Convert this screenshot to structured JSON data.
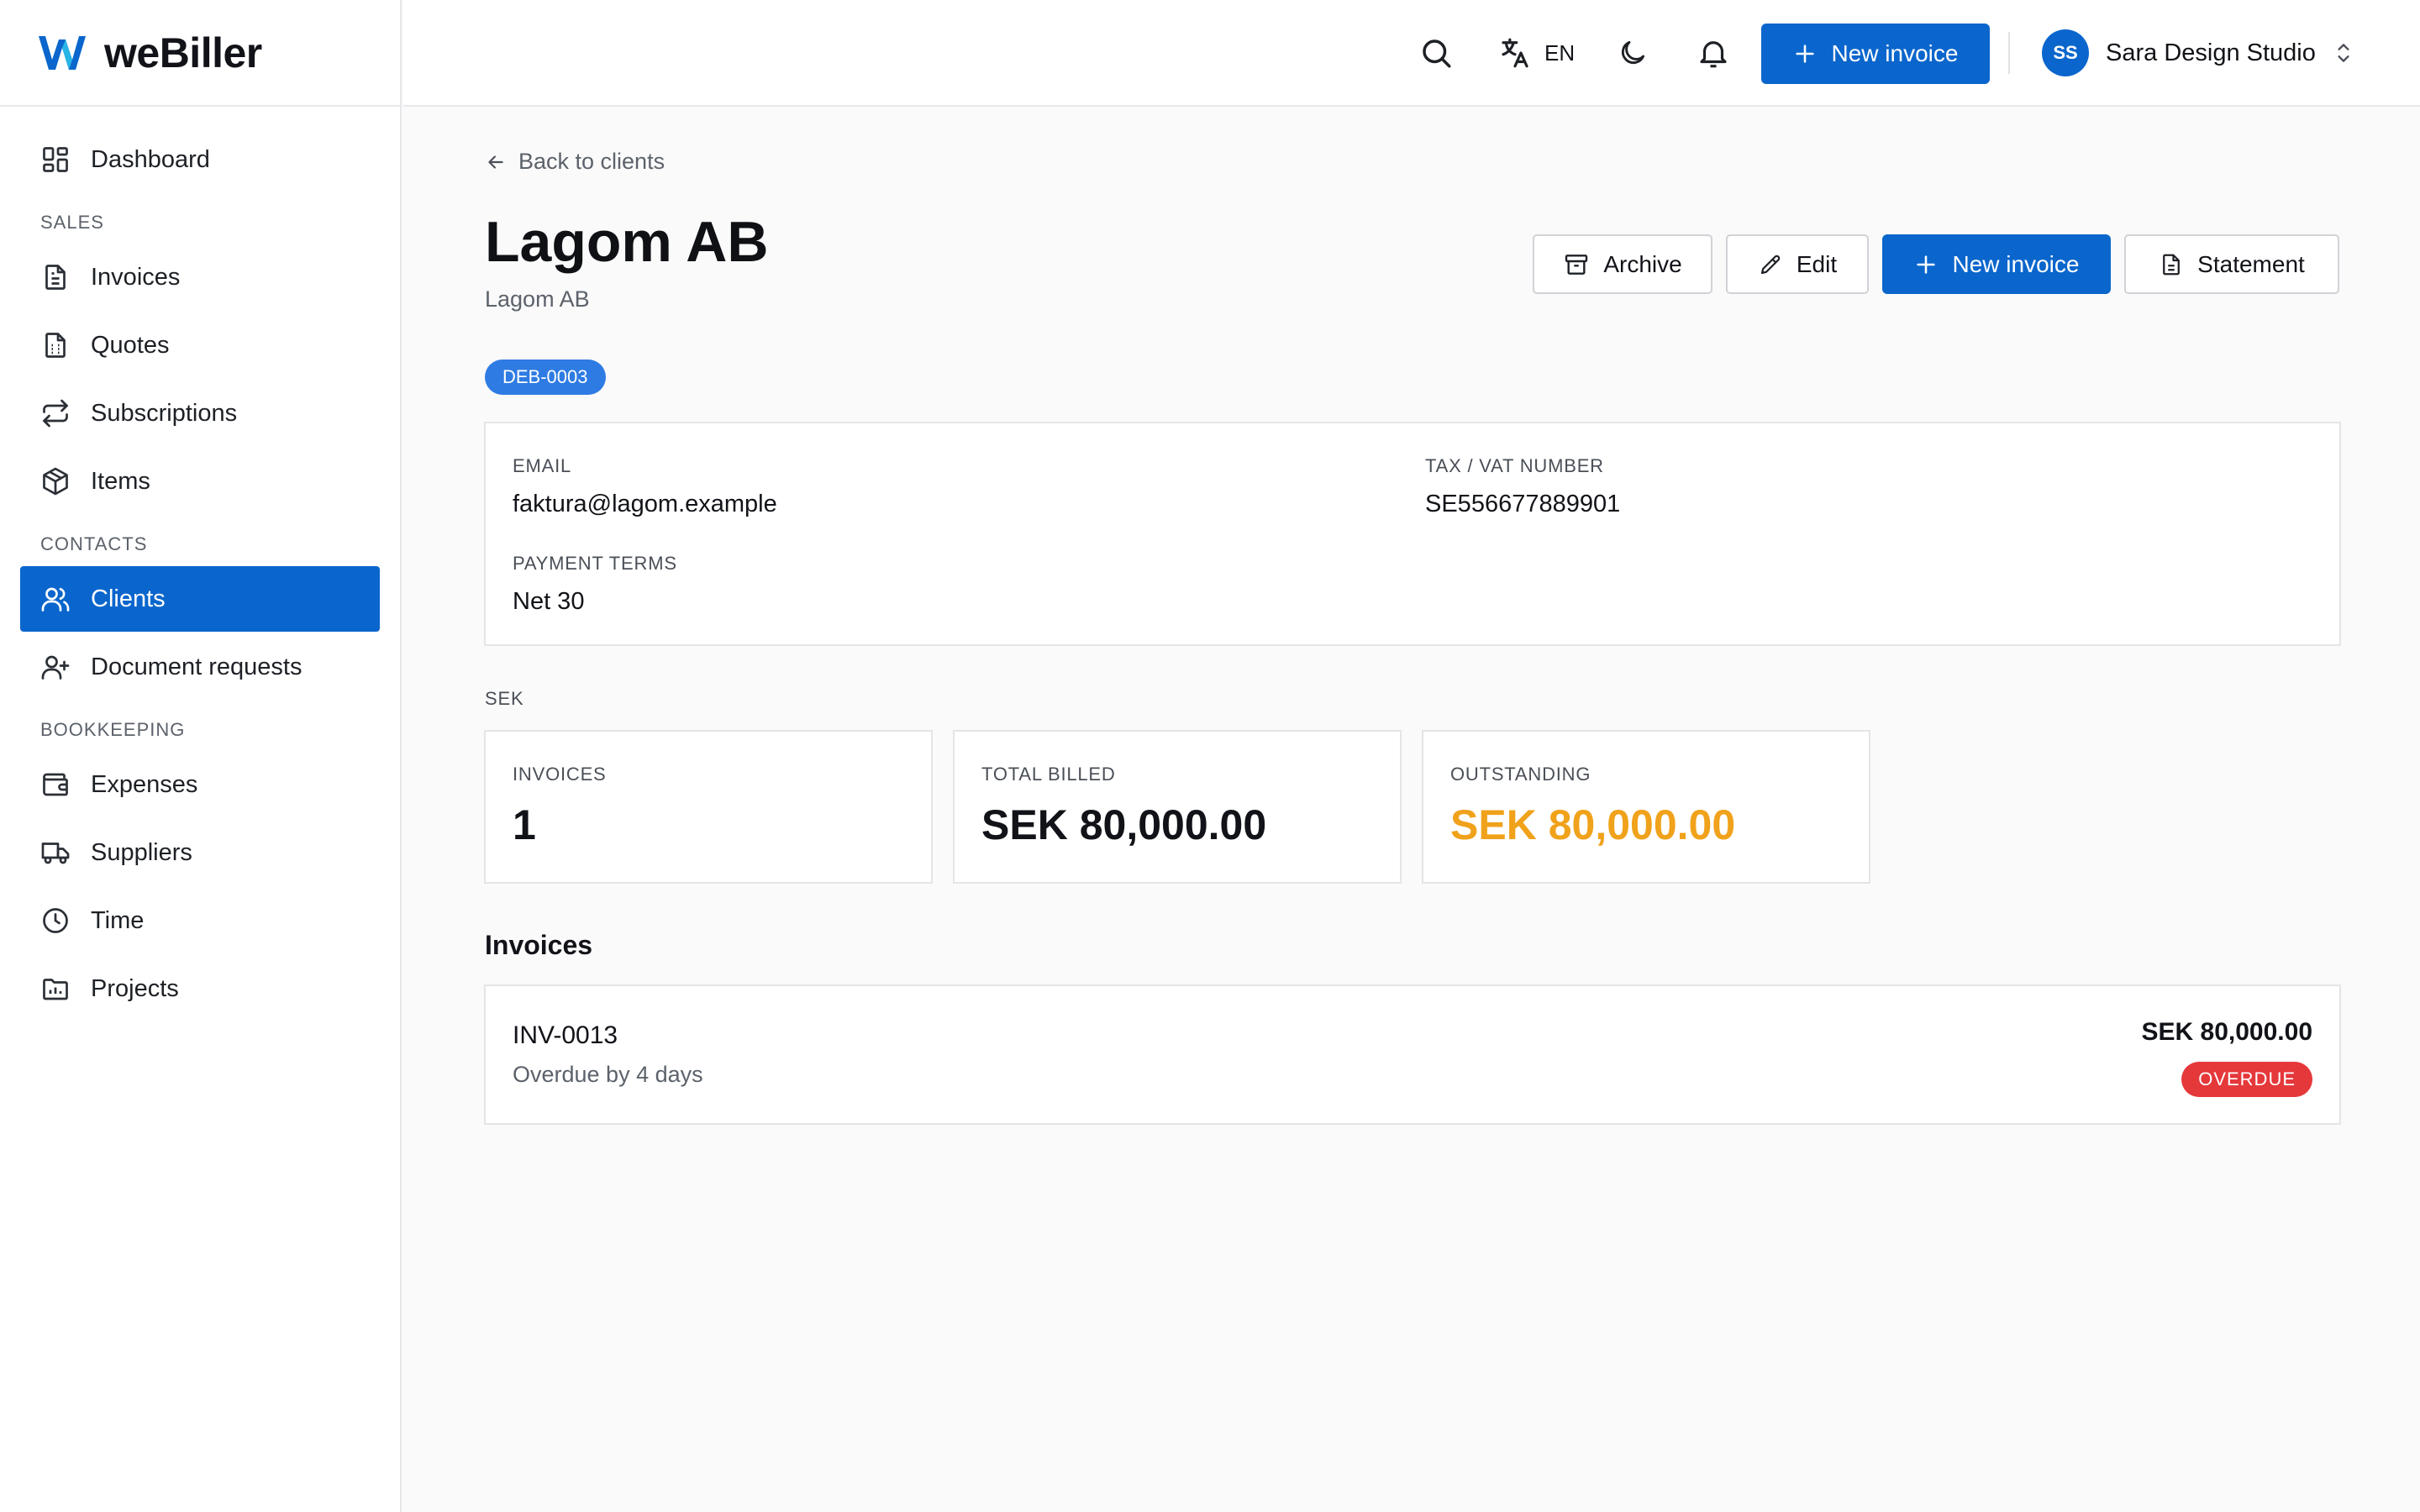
{
  "app": {
    "name": "weBiller"
  },
  "sidebar": {
    "items": [
      {
        "label": "Dashboard",
        "icon": "dashboard-icon"
      },
      {
        "section": "SALES"
      },
      {
        "label": "Invoices",
        "icon": "file-text-icon"
      },
      {
        "label": "Quotes",
        "icon": "calculator-document-icon"
      },
      {
        "label": "Subscriptions",
        "icon": "repeat-icon"
      },
      {
        "label": "Items",
        "icon": "package-icon"
      },
      {
        "section": "CONTACTS"
      },
      {
        "label": "Clients",
        "icon": "users-icon",
        "active": true
      },
      {
        "label": "Document requests",
        "icon": "user-plus-icon"
      },
      {
        "section": "BOOKKEEPING"
      },
      {
        "label": "Expenses",
        "icon": "wallet-icon"
      },
      {
        "label": "Suppliers",
        "icon": "truck-icon"
      },
      {
        "label": "Time",
        "icon": "clock-icon"
      },
      {
        "label": "Projects",
        "icon": "folder-chart-icon"
      }
    ]
  },
  "topbar": {
    "language": "EN",
    "new_invoice_label": "New invoice",
    "user_initials": "SS",
    "org_name": "Sara Design Studio"
  },
  "client": {
    "back_label": "Back to clients",
    "name": "Lagom AB",
    "subtitle": "Lagom AB",
    "code": "DEB-0003",
    "actions": {
      "archive": "Archive",
      "edit": "Edit",
      "new_invoice": "New invoice",
      "statement": "Statement"
    },
    "details": {
      "email_label": "EMAIL",
      "email": "faktura@lagom.example",
      "tax_label": "TAX / VAT NUMBER",
      "tax": "SE556677889901",
      "terms_label": "PAYMENT TERMS",
      "terms": "Net 30"
    }
  },
  "summary": {
    "currency": "SEK",
    "stats": [
      {
        "label": "INVOICES",
        "value": "1"
      },
      {
        "label": "TOTAL BILLED",
        "value": "SEK 80,000.00"
      },
      {
        "label": "OUTSTANDING",
        "value": "SEK 80,000.00",
        "color": "#f0a21b"
      }
    ]
  },
  "invoices": {
    "title": "Invoices",
    "rows": [
      {
        "number": "INV-0013",
        "status_text": "Overdue by 4 days",
        "amount": "SEK 80,000.00",
        "badge": "OVERDUE",
        "badge_color": "#e5383b"
      }
    ]
  },
  "colors": {
    "accent": "#0a66cc",
    "badge": "#2e7be3",
    "outstanding": "#f0a21b",
    "overdue": "#e5383b"
  }
}
